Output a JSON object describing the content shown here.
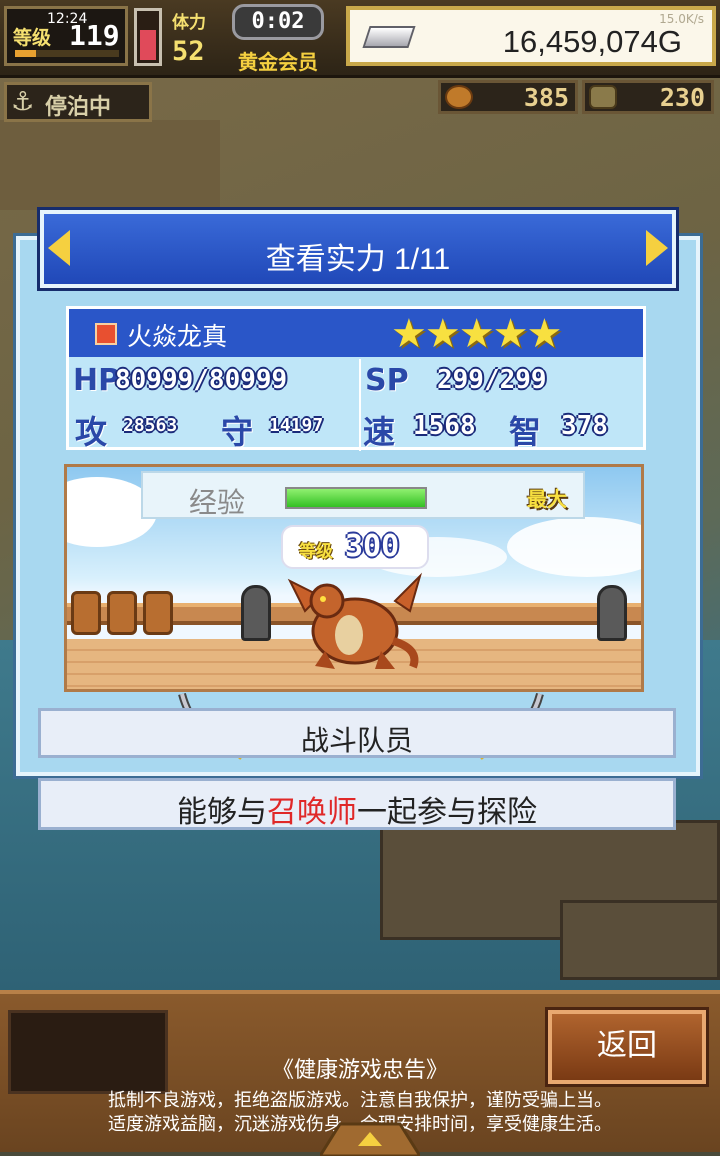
{
  "status_bar": {
    "time": "12:24",
    "net_speed": "15.0K/s"
  },
  "hud": {
    "level_label": "等级",
    "level_value": "119",
    "level_progress": 0.2,
    "stamina_level": 0.7,
    "points_label": "体力",
    "points_value": "52",
    "timer": "0:02",
    "membership": "黄金会员",
    "money": "16,459,074G",
    "anchor_label": "停泊中",
    "resource1": {
      "icon": "medal-icon",
      "value": "385"
    },
    "resource2": {
      "icon": "coin-icon",
      "value": "230"
    }
  },
  "panel": {
    "title": "查看实力 1/11",
    "character": {
      "element_icon": "fire-element-icon",
      "name": "火焱龙真",
      "stars": "★★★★★",
      "hp_label": "HP",
      "hp_value": "80999/80999",
      "sp_label": "SP",
      "sp_value": "299/299",
      "atk_label": "攻",
      "atk_value": "28563",
      "def_label": "守",
      "def_value": "14197",
      "spd_label": "速",
      "spd_value": "1568",
      "int_label": "智",
      "int_value": "378"
    },
    "exp_label": "经验",
    "exp_progress": 1.0,
    "exp_max_label": "最大",
    "level_label": "等级",
    "level_value": "300",
    "role": "战斗队员",
    "description": {
      "before": "能够与",
      "highlight": "召唤师",
      "after": "一起参与探险"
    }
  },
  "bottom": {
    "back_label": "返回",
    "notice_title": "《健康游戏忠告》",
    "notice_line1": "抵制不良游戏，拒绝盗版游戏。注意自我保护，谨防受骗上当。",
    "notice_line2": "适度游戏益脑，沉迷游戏伤身。合理安排时间，享受健康生活。"
  },
  "colors": {
    "accent_gold": "#f5d040",
    "title_blue": "#2a56c8",
    "highlight_red": "#e02828"
  }
}
